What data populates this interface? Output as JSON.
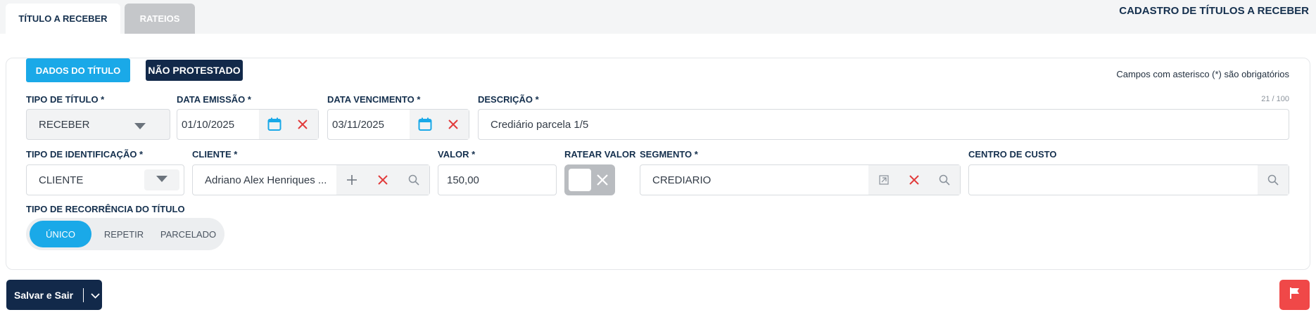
{
  "tabs": [
    {
      "label": "TÍTULO A RECEBER",
      "active": true
    },
    {
      "label": "RATEIOS",
      "active": false
    }
  ],
  "page_title": "CADASTRO DE TÍTULOS A RECEBER",
  "section": {
    "title_chip": "DADOS DO TÍTULO",
    "status_chip": "NÃO PROTESTADO",
    "required_note": "Campos com asterisco (*) são obrigatórios"
  },
  "fields": {
    "tipo_titulo": {
      "label": "TIPO DE TÍTULO *",
      "value": "RECEBER"
    },
    "data_emissao": {
      "label": "DATA EMISSÃO *",
      "value": "01/10/2025"
    },
    "data_vencimento": {
      "label": "DATA VENCIMENTO *",
      "value": "03/11/2025"
    },
    "descricao": {
      "label": "DESCRIÇÃO *",
      "value": "Crediário parcela 1/5",
      "counter": "21 / 100"
    },
    "tipo_identificacao": {
      "label": "TIPO DE IDENTIFICAÇÃO *",
      "value": "CLIENTE"
    },
    "cliente": {
      "label": "CLIENTE *",
      "value": "Adriano Alex Henriques ..."
    },
    "valor": {
      "label": "VALOR *",
      "value": "150,00"
    },
    "ratear_valor": {
      "label": "RATEAR VALOR",
      "checked": false
    },
    "segmento": {
      "label": "SEGMENTO *",
      "value": "CREDIARIO"
    },
    "centro_custo": {
      "label": "CENTRO DE CUSTO",
      "value": ""
    },
    "recorrencia": {
      "label": "TIPO DE RECORRÊNCIA DO TÍTULO",
      "options": [
        "ÚNICO",
        "REPETIR",
        "PARCELADO"
      ],
      "selected": "ÚNICO"
    }
  },
  "footer": {
    "save_label": "Salvar e Sair"
  },
  "icons": {
    "calendar": "calendar-icon",
    "clear": "close-icon",
    "search": "search-icon",
    "add": "plus-icon",
    "open": "open-link-icon",
    "dropdown": "chevron-down-icon",
    "flag": "flag-icon"
  },
  "colors": {
    "accent": "#1aa9e8",
    "dark": "#12294a",
    "danger": "#f04848",
    "clear_x": "#e23b3b"
  }
}
